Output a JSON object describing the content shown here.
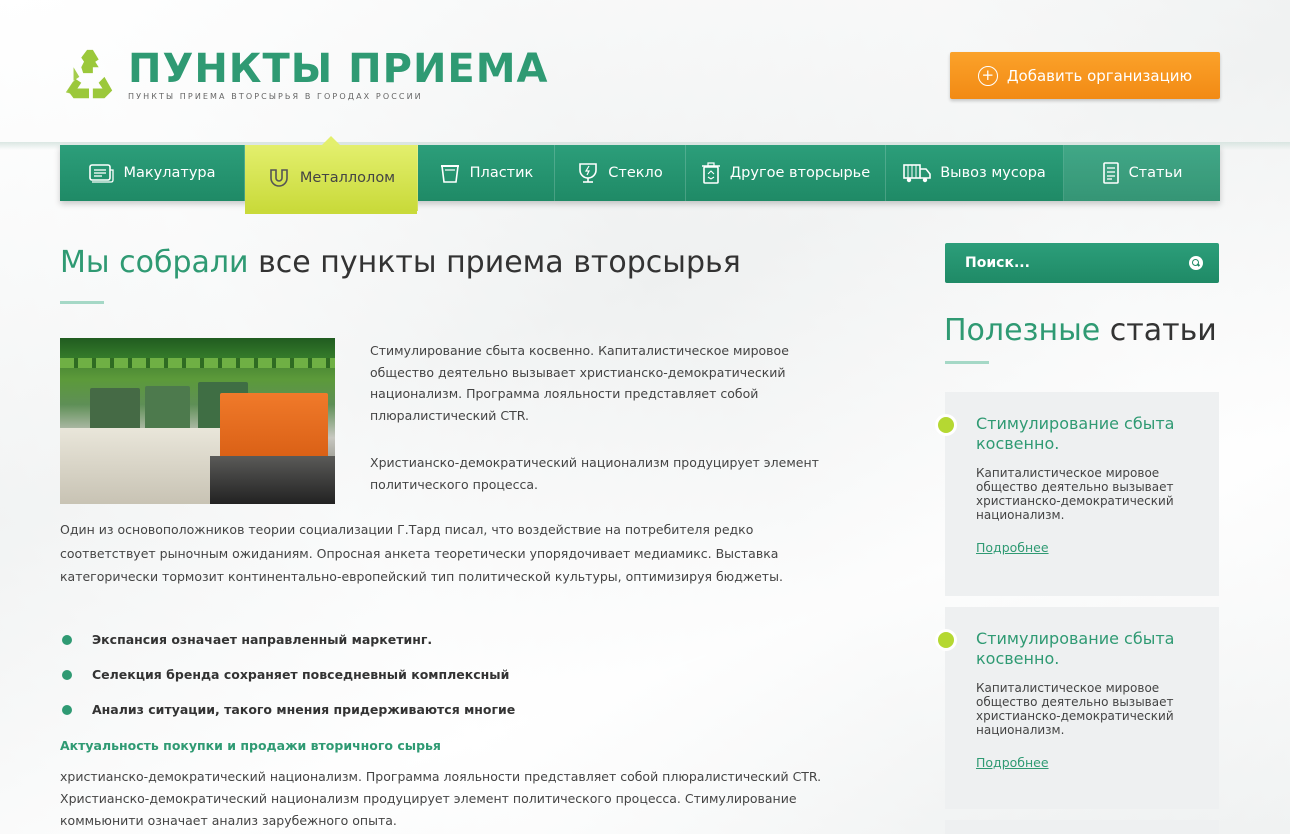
{
  "header": {
    "logo_title": "ПУНКТЫ ПРИЕМА",
    "logo_subtitle": "ПУНКТЫ ПРИЕМА ВТОРСЫРЬЯ В ГОРОДАХ РОССИИ",
    "add_button_label": "Добавить организацию"
  },
  "nav": {
    "items": [
      {
        "label": "Макулатура",
        "icon": "newspaper-icon"
      },
      {
        "label": "Металлолом",
        "icon": "magnet-icon",
        "active": true
      },
      {
        "label": "Пластик",
        "icon": "bucket-icon"
      },
      {
        "label": "Стекло",
        "icon": "glass-icon"
      },
      {
        "label": "Другое вторсырье",
        "icon": "recycle-bin-icon"
      },
      {
        "label": "Вывоз мусора",
        "icon": "truck-icon"
      },
      {
        "label": "Статьи",
        "icon": "document-icon"
      }
    ]
  },
  "main": {
    "title_accent": "Мы собрали",
    "title_rest": " все пункты приема вторсырья",
    "para1": "Стимулирование сбыта косвенно. Капиталистическое мировое общество деятельно вызывает христианско-демократический национализм. Программа лояльности представляет собой плюралистический CTR.",
    "para2": "Христианско-демократический национализм продуцирует элемент политического процесса.",
    "para3": "Один из основоположников теории социализации Г.Тард писал, что воздействие на потребителя редко соответствует рыночным ожиданиям. Опросная анкета теоретически упорядочивает медиамикс. Выставка категорически тормозит континентально-европейский тип политической культуры, оптимизируя бюджеты.",
    "bullets": [
      "Экспансия означает направленный маркетинг.",
      "Селекция бренда сохраняет повседневный комплексный",
      "Анализ ситуации, такого мнения придерживаются многие"
    ],
    "subheading": "Актуальность покупки и продажи вторичного сырья",
    "para4": "христианско-демократический национализм. Программа лояльности представляет собой плюралистический CTR. Христианско-демократический национализм продуцирует элемент политического процесса. Стимулирование коммьюнити означает анализ зарубежного опыта."
  },
  "sidebar": {
    "search_placeholder": "Поиск...",
    "heading_accent": "Полезные",
    "heading_rest": " статьи",
    "cards": [
      {
        "title": "Стимулирование сбыта косвенно.",
        "text": "Капиталистическое мировое общество деятельно вызывает христианско-демократический национализм.",
        "link": "Подробнее"
      },
      {
        "title": "Стимулирование сбыта косвенно.",
        "text": "Капиталистическое мировое общество деятельно вызывает христианско-демократический национализм.",
        "link": "Подробнее"
      }
    ]
  },
  "colors": {
    "brand_green": "#2f9a73",
    "nav_active": "#d6e55a",
    "button_orange": "#f7961f"
  }
}
